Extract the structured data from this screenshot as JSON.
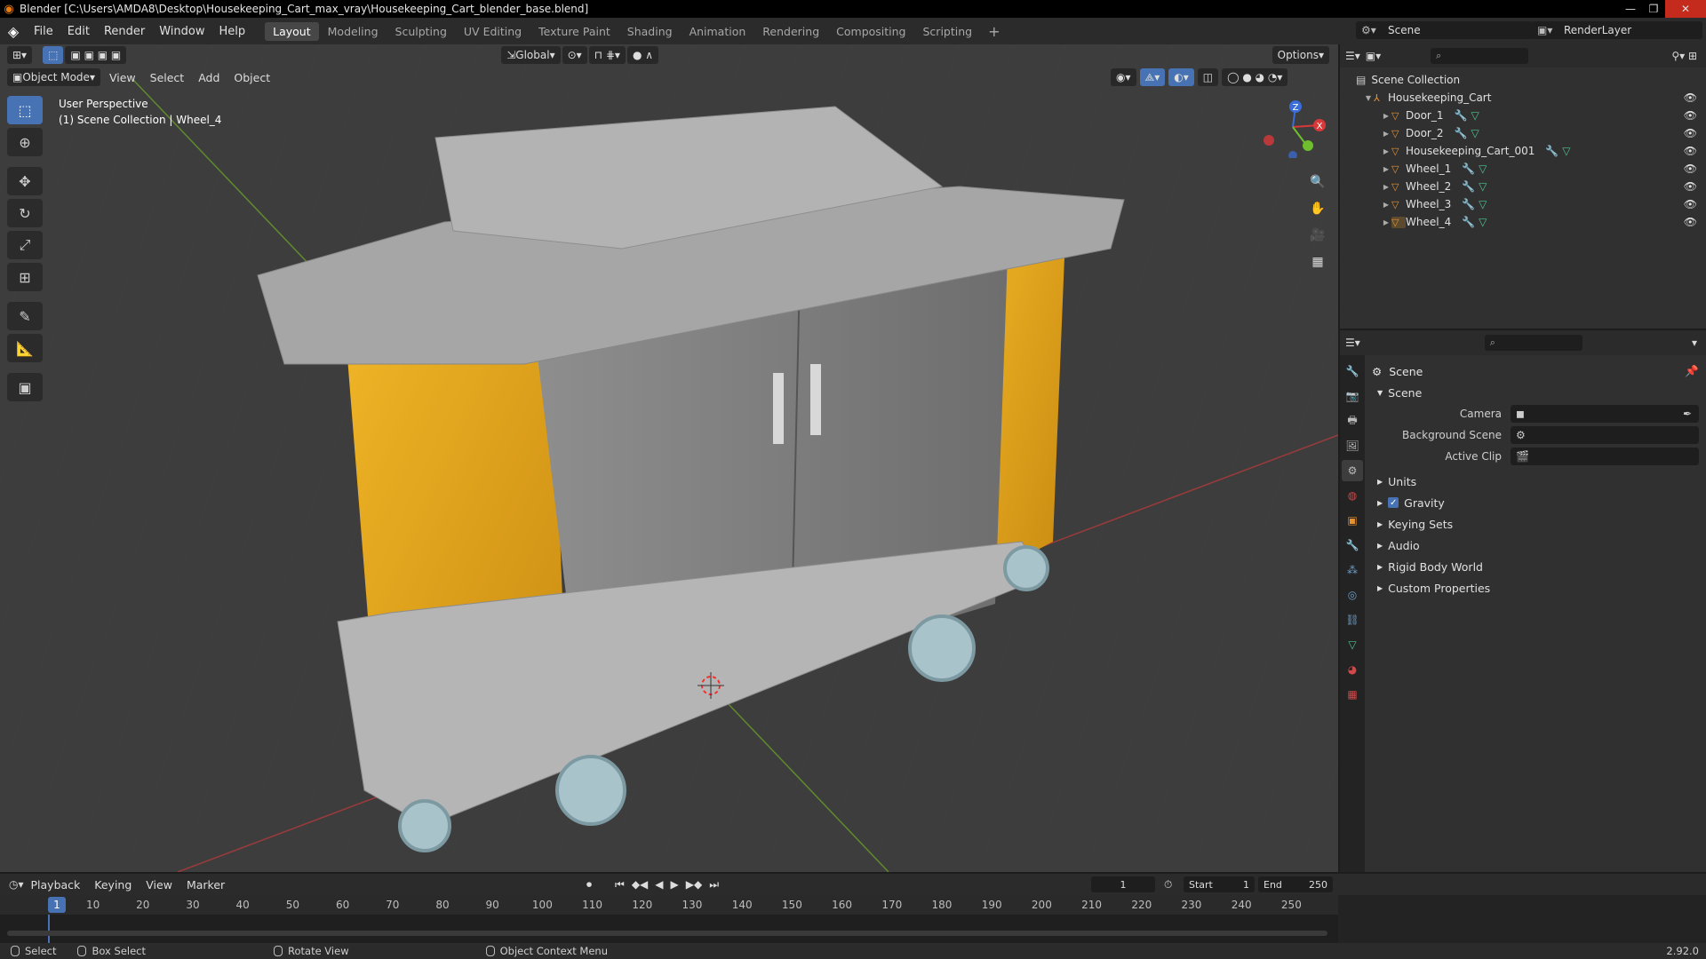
{
  "window": {
    "title": "Blender [C:\\Users\\AMDA8\\Desktop\\Housekeeping_Cart_max_vray\\Housekeeping_Cart_blender_base.blend]"
  },
  "menubar": {
    "menus": [
      "File",
      "Edit",
      "Render",
      "Window",
      "Help"
    ],
    "workspaces": [
      "Layout",
      "Modeling",
      "Sculpting",
      "UV Editing",
      "Texture Paint",
      "Shading",
      "Animation",
      "Rendering",
      "Compositing",
      "Scripting"
    ],
    "active_workspace": "Layout",
    "scene": "Scene",
    "render_layer": "RenderLayer"
  },
  "viewport": {
    "mode": "Object Mode",
    "menus": [
      "View",
      "Select",
      "Add",
      "Object"
    ],
    "transform_orientation": "Global",
    "options_label": "Options",
    "info_line1": "User Perspective",
    "info_line2": "(1) Scene Collection | Wheel_4",
    "gizmo_axes": [
      "Z",
      "X",
      "Y"
    ]
  },
  "outliner": {
    "root": "Scene Collection",
    "collection": "Housekeeping_Cart",
    "objects": [
      "Door_1",
      "Door_2",
      "Housekeeping_Cart_001",
      "Wheel_1",
      "Wheel_2",
      "Wheel_3",
      "Wheel_4"
    ]
  },
  "properties": {
    "context": "Scene",
    "panel": "Scene",
    "fields": [
      {
        "label": "Camera",
        "value": ""
      },
      {
        "label": "Background Scene",
        "value": ""
      },
      {
        "label": "Active Clip",
        "value": ""
      }
    ],
    "sections": [
      "Units",
      "Gravity",
      "Keying Sets",
      "Audio",
      "Rigid Body World",
      "Custom Properties"
    ],
    "gravity_checked": true
  },
  "timeline": {
    "menus": [
      "Playback",
      "Keying",
      "View",
      "Marker"
    ],
    "current_frame": "1",
    "start_label": "Start",
    "start": "1",
    "end_label": "End",
    "end": "250",
    "ticks": [
      "10",
      "20",
      "30",
      "40",
      "50",
      "60",
      "70",
      "80",
      "90",
      "100",
      "110",
      "120",
      "130",
      "140",
      "150",
      "160",
      "170",
      "180",
      "190",
      "200",
      "210",
      "220",
      "230",
      "240",
      "250"
    ],
    "cursor_label": "1"
  },
  "statusbar": {
    "items": [
      "Select",
      "Box Select",
      "Rotate View",
      "Object Context Menu"
    ],
    "version": "2.92.0"
  },
  "colors": {
    "accent": "#4772b3",
    "viewport_bg": "#3d3d3d",
    "object_icon": "#e8922f",
    "mesh_icon": "#4fc38d",
    "cart_yellow": "#e6a91c"
  }
}
